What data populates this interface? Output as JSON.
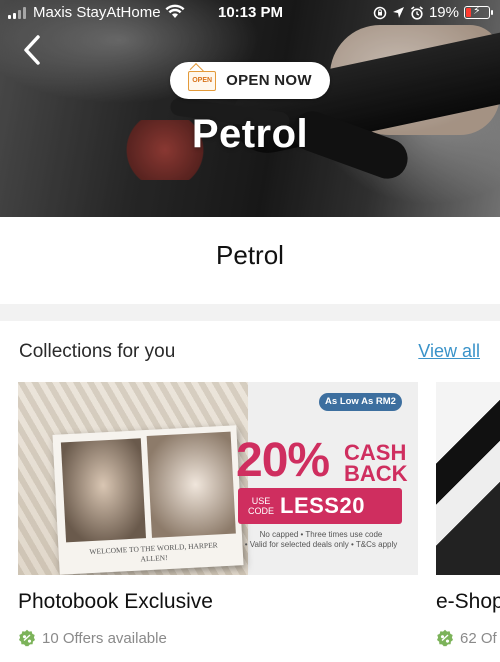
{
  "status_bar": {
    "carrier": "Maxis StayAtHome",
    "time": "10:13 PM",
    "battery": "19%",
    "icons": [
      "signal-icon",
      "wifi-icon",
      "orientation-lock-icon",
      "location-arrow-icon",
      "alarm-icon",
      "battery-charging-icon"
    ]
  },
  "hero": {
    "badge_sign": "OPEN",
    "badge_label": "OPEN NOW",
    "title": "Petrol"
  },
  "page": {
    "title": "Petrol"
  },
  "collections": {
    "heading": "Collections for you",
    "view_all": "View all",
    "cards": [
      {
        "name": "Photobook Exclusive",
        "offers": "10 Offers available",
        "promo": {
          "badge": "As Low As RM2",
          "percent": "20%",
          "cash_back": "CASH BACK",
          "use_code": "USE CODE",
          "code": "LESS20",
          "terms_1": "No capped • Three times use code",
          "terms_2": "• Valid for selected deals only • T&Cs apply",
          "book_caption": "WELCOME TO THE WORLD, HARPER ALLEN!"
        }
      },
      {
        "name": "e-Shop",
        "offers": "62 Of"
      }
    ]
  },
  "colors": {
    "accent_link": "#3a93c9",
    "promo_pink": "#cf2e5f",
    "offer_icon_green": "#7cb35a",
    "promo_badge_blue": "#3d6f9f"
  }
}
